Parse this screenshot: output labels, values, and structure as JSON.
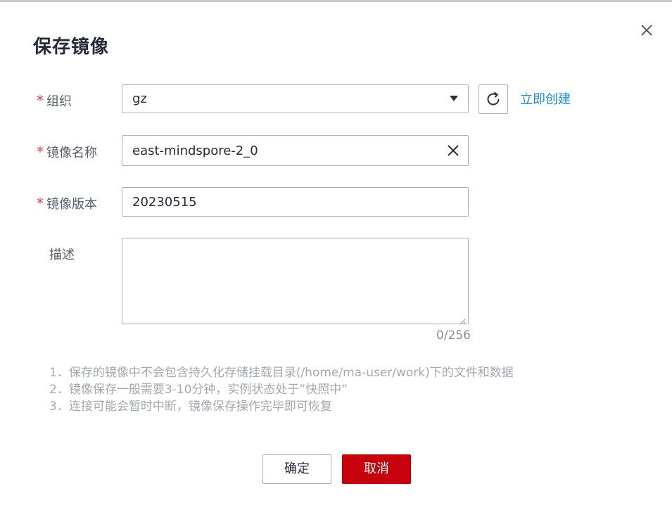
{
  "dialog": {
    "title": "保存镜像",
    "close_icon": "close-icon"
  },
  "form": {
    "org": {
      "required_mark": "*",
      "label": "组织",
      "selected": "gz",
      "refresh_icon": "refresh-icon",
      "create_link": "立即创建"
    },
    "name": {
      "required_mark": "*",
      "label": "镜像名称",
      "value": "east-mindspore-2_0",
      "clear_icon": "clear-icon"
    },
    "version": {
      "required_mark": "*",
      "label": "镜像版本",
      "value": "20230515"
    },
    "description": {
      "label": "描述",
      "value": "",
      "counter": "0/256"
    }
  },
  "notes": [
    "1．保存的镜像中不会包含持久化存储挂载目录(/home/ma-user/work)下的文件和数据",
    "2．镜像保存一般需要3-10分钟，实例状态处于”快照中”",
    "3．连接可能会暂时中断，镜像保存操作完毕即可恢复"
  ],
  "footer": {
    "ok_label": "确定",
    "cancel_label": "取消"
  },
  "colors": {
    "accent": "#c7000b",
    "link": "#1f8bd9",
    "required": "#e64545"
  }
}
